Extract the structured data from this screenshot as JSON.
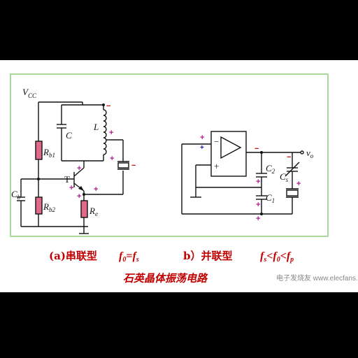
{
  "labels": {
    "vcc": "V",
    "vcc_sub": "CC",
    "c": "C",
    "l": "L",
    "rb1": "R",
    "rb1_sub": "b1",
    "rb2": "R",
    "rb2_sub": "b2",
    "cb": "C",
    "cb_sub": "b",
    "t": "T",
    "re": "R",
    "re_sub": "e",
    "c2": "C",
    "c2_sub": "2",
    "c1": "C",
    "c1_sub": "1",
    "cs": "C",
    "cs_sub": "s",
    "vo": "v",
    "vo_sub": "o"
  },
  "caption": {
    "line1_a": "(a)串联型",
    "line1_a_eq": "f",
    "line1_a_eq_sub0": "0",
    "line1_a_eq_mid": "=",
    "line1_a_eq_f": "f",
    "line1_a_eq_subs": "s",
    "line1_b": "b）并联型",
    "line1_b_f1": "f",
    "line1_b_f1_sub": "s",
    "line1_b_lt1": "<",
    "line1_b_f2": "f",
    "line1_b_f2_sub": "0",
    "line1_b_lt2": "<",
    "line1_b_f3": "f",
    "line1_b_f3_sub": "p",
    "line2": "石英晶体振荡电路"
  },
  "watermark": "电子发烧友 www.elecfans.com",
  "colors": {
    "panel_border": "#a9d8a0",
    "resistor": "#e06a8a",
    "caption": "#c00000",
    "plus": "#b0198f",
    "minus": "#c01010"
  }
}
